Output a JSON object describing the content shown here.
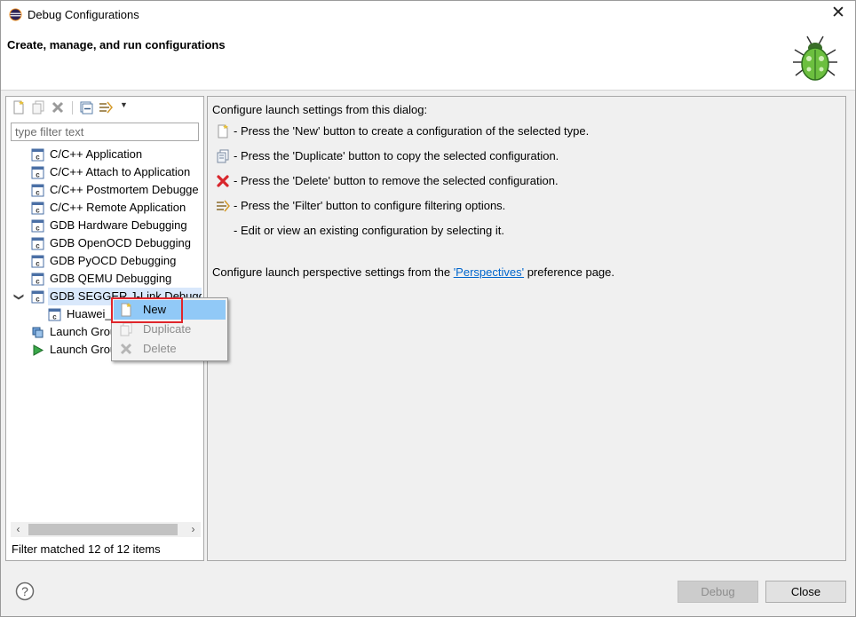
{
  "window": {
    "title": "Debug Configurations"
  },
  "header": {
    "heading": "Create, manage, and run configurations",
    "icon": "bug-icon"
  },
  "left": {
    "filter_placeholder": "type filter text",
    "tree": [
      {
        "label": "C/C++ Application",
        "icon": "c-config-icon"
      },
      {
        "label": "C/C++ Attach to Application",
        "icon": "c-config-icon"
      },
      {
        "label": "C/C++ Postmortem Debugge",
        "icon": "c-config-icon"
      },
      {
        "label": "C/C++ Remote Application",
        "icon": "c-config-icon"
      },
      {
        "label": "GDB Hardware Debugging",
        "icon": "c-config-icon"
      },
      {
        "label": "GDB OpenOCD Debugging",
        "icon": "c-config-icon"
      },
      {
        "label": "GDB PyOCD Debugging",
        "icon": "c-config-icon"
      },
      {
        "label": "GDB QEMU Debugging",
        "icon": "c-config-icon"
      },
      {
        "label": "GDB SEGGER J-Link Debuggi",
        "icon": "c-config-icon",
        "expanded": true,
        "selected": true
      },
      {
        "label": "Huawei_I",
        "icon": "c-config-icon"
      },
      {
        "label": "Launch Grou",
        "icon": "launch-group-icon"
      },
      {
        "label": "Launch Grou",
        "icon": "launch-group-run-icon"
      }
    ],
    "footer": "Filter matched 12 of 12 items"
  },
  "right": {
    "intro": "Configure launch settings from this dialog:",
    "lines": [
      {
        "icon": "new-icon",
        "text": "- Press the 'New' button to create a configuration of the selected type."
      },
      {
        "icon": "duplicate-icon",
        "text": "- Press the 'Duplicate' button to copy the selected configuration."
      },
      {
        "icon": "delete-icon",
        "text": "- Press the 'Delete' button to remove the selected configuration."
      },
      {
        "icon": "filter-icon",
        "text": "- Press the 'Filter' button to configure filtering options."
      },
      {
        "icon": "",
        "text": "- Edit or view an existing configuration by selecting it."
      }
    ],
    "perspective_prefix": "Configure launch perspective settings from the ",
    "perspective_link": "'Perspectives'",
    "perspective_suffix": " preference page."
  },
  "context_menu": {
    "items": [
      {
        "label": "New",
        "enabled": true,
        "highlighted": true
      },
      {
        "label": "Duplicate",
        "enabled": false
      },
      {
        "label": "Delete",
        "enabled": false
      }
    ]
  },
  "buttons": {
    "debug": "Debug",
    "close": "Close"
  },
  "colors": {
    "highlight": "#91c9f7",
    "annotation": "#e0252b",
    "link": "#0066cc",
    "selection": "#d9e8fb"
  }
}
